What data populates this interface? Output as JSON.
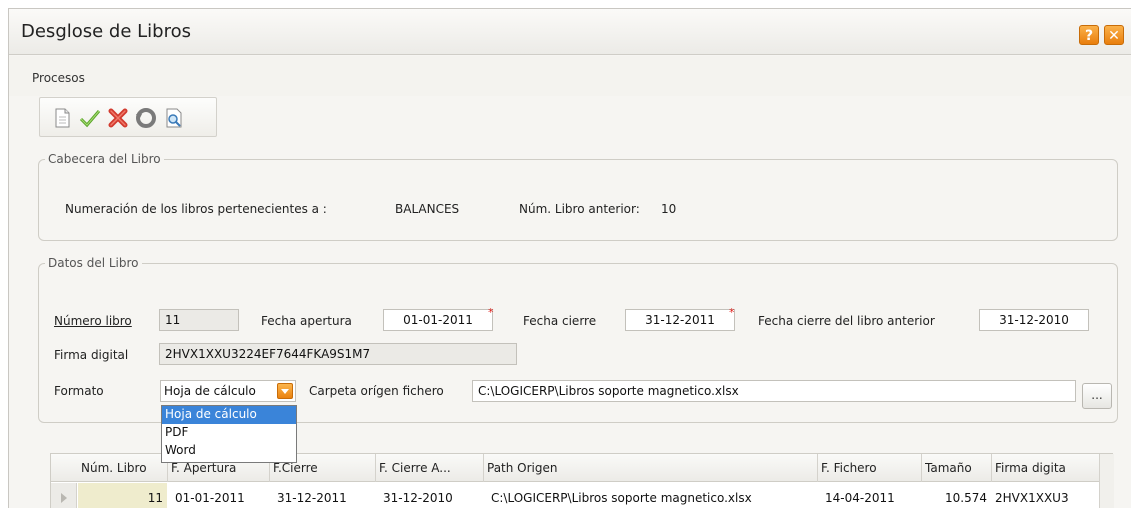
{
  "window": {
    "title": "Desglose de Libros"
  },
  "titlebar_buttons": {
    "help": "?",
    "close": "✕"
  },
  "menu": {
    "items": [
      "Procesos"
    ]
  },
  "toolbar": {
    "icons": [
      "new-document-icon",
      "checkmark-icon",
      "delete-x-icon",
      "refresh-icon",
      "preview-icon"
    ]
  },
  "cabecera": {
    "legend": "Cabecera del Libro",
    "numeracion_label": "Numeración de los libros pertenecientes a :",
    "numeracion_value": "BALANCES",
    "libro_anterior_label": "Núm. Libro anterior:",
    "libro_anterior_value": "10"
  },
  "datos": {
    "legend": "Datos del Libro",
    "numero_libro_label": "Número libro",
    "numero_libro_value": "11",
    "fecha_apertura_label": "Fecha apertura",
    "fecha_apertura_value": "01-01-2011",
    "fecha_cierre_label": "Fecha cierre",
    "fecha_cierre_value": "31-12-2011",
    "fecha_cierre_anterior_label": "Fecha cierre del libro anterior",
    "fecha_cierre_anterior_value": "31-12-2010",
    "required_mark": "*",
    "firma_label": "Firma digital",
    "firma_value": "2HVX1XXU3224EF7644FKA9S1M7",
    "formato_label": "Formato",
    "formato_value": "Hoja de cálculo",
    "formato_options": [
      "Hoja de cálculo",
      "PDF",
      "Word"
    ],
    "carpeta_label": "Carpeta orígen fichero",
    "carpeta_value": "C:\\LOGICERP\\Libros soporte magnetico.xlsx",
    "browse_label": "..."
  },
  "grid": {
    "columns": [
      "Núm. Libro",
      "F. Apertura",
      "F.Cierre",
      "F. Cierre A...",
      "Path Origen",
      "F. Fichero",
      "Tamaño",
      "Firma digita"
    ],
    "rows": [
      [
        "11",
        "01-01-2011",
        "31-12-2011",
        "31-12-2010",
        "C:\\LOGICERP\\Libros soporte magnetico.xlsx",
        "14-04-2011",
        "10.574",
        "2HVX1XXU3"
      ]
    ]
  },
  "colors": {
    "accent_orange": "#ea820f",
    "selection_blue": "#3a84d9",
    "required_red": "#e0201c"
  }
}
